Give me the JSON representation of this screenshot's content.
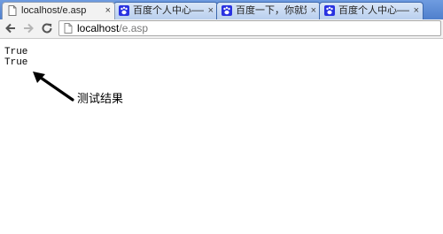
{
  "browser": {
    "tabs": [
      {
        "title": "localhost/e.asp",
        "active": true,
        "close_icon": "×"
      },
      {
        "title": "百度个人中心——切",
        "active": false,
        "close_icon": "×"
      },
      {
        "title": "百度一下，你就知道",
        "active": false,
        "close_icon": "×"
      },
      {
        "title": "百度个人中心——切",
        "active": false,
        "close_icon": "×"
      }
    ],
    "address_bar": {
      "host": "localhost",
      "path": "/e.asp"
    },
    "icons": [
      "back-icon",
      "forward-icon",
      "reload-icon",
      "page-icon",
      "baidu-paw-icon",
      "close-icon"
    ]
  },
  "page": {
    "output_lines": [
      "True",
      "True"
    ],
    "annotation": "测试结果"
  },
  "colors": {
    "tabbar": "#4f7fcc",
    "active_tab": "#f2f2f2",
    "baidu_blue": "#2932e1"
  }
}
